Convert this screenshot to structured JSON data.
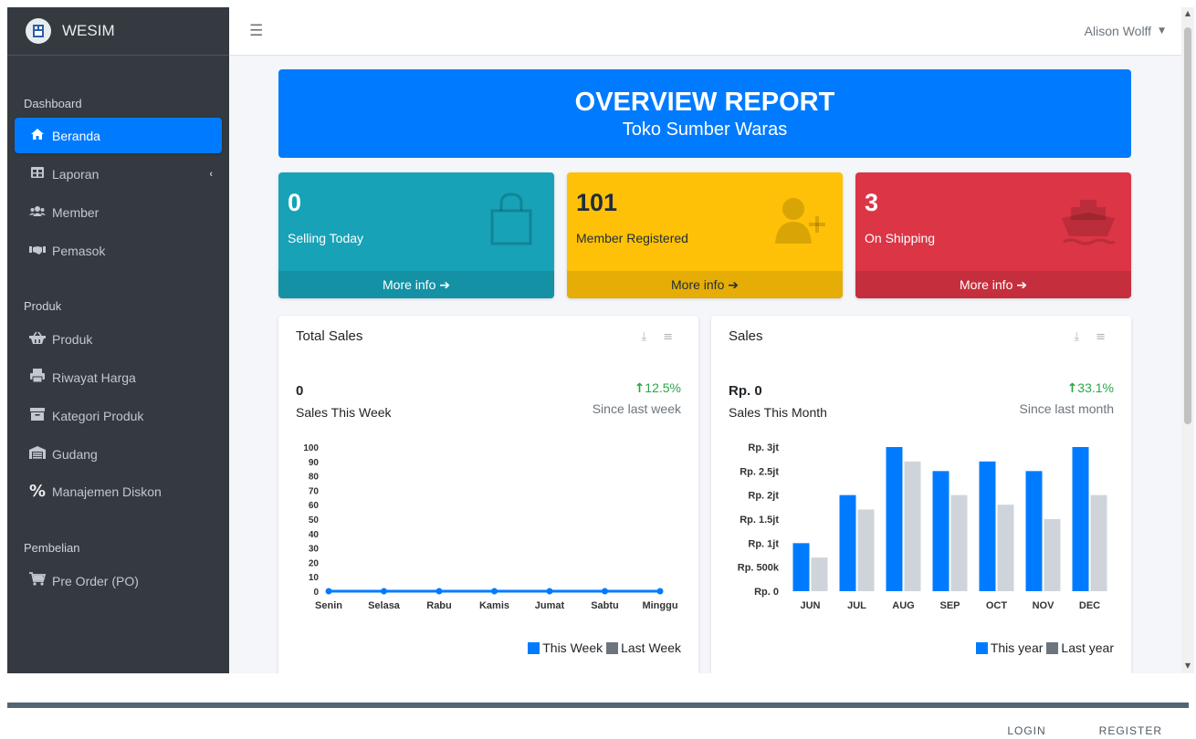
{
  "brand": {
    "logo_text": "",
    "name": "WESIM"
  },
  "topbar": {
    "user_name": "Alison Wolff"
  },
  "sidebar": {
    "sections": [
      {
        "header": "Dashboard",
        "items": [
          {
            "label": "Beranda",
            "icon": "home-icon",
            "active": true
          },
          {
            "label": "Laporan",
            "icon": "table-icon",
            "has_caret": true
          },
          {
            "label": "Member",
            "icon": "users-icon"
          },
          {
            "label": "Pemasok",
            "icon": "handshake-icon"
          }
        ]
      },
      {
        "header": "Produk",
        "items": [
          {
            "label": "Produk",
            "icon": "basket-icon"
          },
          {
            "label": "Riwayat Harga",
            "icon": "print-icon"
          },
          {
            "label": "Kategori Produk",
            "icon": "archive-icon"
          },
          {
            "label": "Gudang",
            "icon": "warehouse-icon"
          },
          {
            "label": "Manajemen Diskon",
            "icon": "percent-icon"
          }
        ]
      },
      {
        "header": "Pembelian",
        "items": [
          {
            "label": "Pre Order (PO)",
            "icon": "cart-icon"
          }
        ]
      }
    ]
  },
  "banner": {
    "title": "OVERVIEW REPORT",
    "subtitle": "Toko Sumber Waras"
  },
  "stats": [
    {
      "value": "0",
      "label": "Selling Today",
      "link": "More info",
      "icon": "shopping-bag-icon",
      "color": "#17a2b8"
    },
    {
      "value": "101",
      "label": "Member Registered",
      "link": "More info",
      "icon": "user-plus-icon",
      "color": "#ffc107"
    },
    {
      "value": "3",
      "label": "On Shipping",
      "link": "More info",
      "icon": "ship-icon",
      "color": "#dc3545"
    }
  ],
  "cards": {
    "total_sales": {
      "title": "Total Sales",
      "big_value": "0",
      "sub_label": "Sales This Week",
      "change": "12.5%",
      "since": "Since last week",
      "legend": [
        "This Week",
        "Last Week"
      ]
    },
    "sales": {
      "title": "Sales",
      "big_value": "Rp. 0",
      "sub_label": "Sales This Month",
      "change": "33.1%",
      "since": "Since last month",
      "legend": [
        "This year",
        "Last year"
      ]
    }
  },
  "chart_data": [
    {
      "type": "line",
      "title": "",
      "categories": [
        "Senin",
        "Selasa",
        "Rabu",
        "Kamis",
        "Jumat",
        "Sabtu",
        "Minggu"
      ],
      "y_ticks": [
        "0",
        "10",
        "20",
        "30",
        "40",
        "50",
        "60",
        "70",
        "80",
        "90",
        "100"
      ],
      "ylim": [
        0,
        100
      ],
      "series": [
        {
          "name": "This Week",
          "values": [
            0,
            0,
            0,
            0,
            0,
            0,
            0
          ],
          "color": "#007bff"
        },
        {
          "name": "Last Week",
          "values": [],
          "color": "#6c757d"
        }
      ]
    },
    {
      "type": "bar",
      "title": "",
      "categories": [
        "JUN",
        "JUL",
        "AUG",
        "SEP",
        "OCT",
        "NOV",
        "DEC"
      ],
      "y_ticks": [
        "Rp. 0",
        "Rp. 500k",
        "Rp. 1jt",
        "Rp. 1.5jt",
        "Rp. 2jt",
        "Rp. 2.5jt",
        "Rp. 3jt"
      ],
      "ylim": [
        0,
        3000000
      ],
      "series": [
        {
          "name": "This year",
          "values": [
            1000000,
            2000000,
            3000000,
            2500000,
            2700000,
            2500000,
            3000000
          ],
          "color": "#007bff"
        },
        {
          "name": "Last year",
          "values": [
            700000,
            1700000,
            2700000,
            2000000,
            1800000,
            1500000,
            2000000
          ],
          "color": "#ced4da"
        }
      ]
    }
  ],
  "footer_links": {
    "login": "LOGIN",
    "register": "REGISTER"
  }
}
